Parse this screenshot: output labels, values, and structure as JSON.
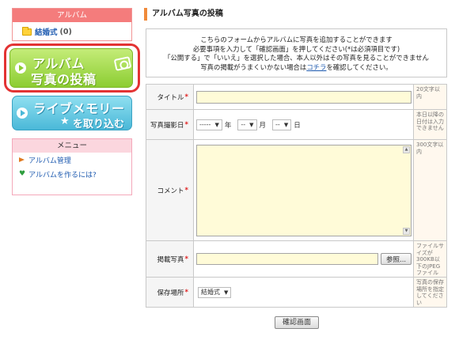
{
  "sidebar": {
    "album_header": "アルバム",
    "album_item_name": "結婚式",
    "album_item_count": "(0)",
    "post_button": {
      "line1": "アルバム",
      "line2": "写真の投稿"
    },
    "memory_button": {
      "line1": "ライブメモリー",
      "line2": "を取り込む"
    },
    "menu_header": "メニュー",
    "menu_items": [
      {
        "label": "アルバム管理"
      },
      {
        "label": "アルバムを作るには?"
      }
    ]
  },
  "main": {
    "title": "アルバム写真の投稿",
    "info": {
      "line1": "こちらのフォームからアルバムに写真を追加することができます",
      "line2": "必要事項を入力して「確認画面」を押してください(*は必須項目です)",
      "line3": "「公開する」で「いいえ」を選択した場合、本人以外はその写真を見ることができません",
      "line4_prefix": "写真の掲載がうまくいかない場合は",
      "line4_link": "コチラ",
      "line4_suffix": "を確認してください。"
    },
    "form": {
      "required_mark": "*",
      "title_label": "タイトル",
      "title_note": "20文字以内",
      "date_label": "写真撮影日",
      "date_year_value": "-----",
      "date_year_unit": "年",
      "date_month_value": "--",
      "date_month_unit": "月",
      "date_day_value": "--",
      "date_day_unit": "日",
      "date_note": "本日以降の日付は入力できません",
      "comment_label": "コメント",
      "comment_note": "300文字以内",
      "photo_label": "掲載写真",
      "browse_label": "参照...",
      "photo_note": "ファイルサイズが300KB以下のJPEGファイル",
      "location_label": "保存場所",
      "location_value": "結婚式",
      "location_note": "写真の保存場所を指定してください"
    },
    "confirm_button": "確認画面"
  },
  "colors": {
    "album_header": "#f47c7c",
    "post_button": "#8ccd32",
    "memory_button": "#4ab8d8",
    "highlight": "#e33333",
    "input_bg": "#fffbd8",
    "link": "#1f5bb0"
  }
}
